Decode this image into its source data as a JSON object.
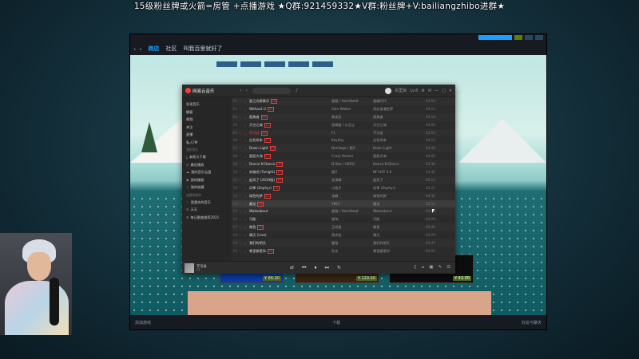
{
  "overlay": {
    "text": "15级粉丝牌或火箭=房管 +点播游戏 ★Q群:921459332★V群:粉丝牌+V:bailiangzhibo进群★"
  },
  "steam": {
    "nav": {
      "back": "‹",
      "forward": "›",
      "tabs": [
        "商店",
        "社区",
        "叫我百里就好了"
      ]
    },
    "bottom": {
      "add_game": "添加游戏",
      "downloads": "下载",
      "friends": "好友与聊天"
    },
    "prices": [
      "¥ 86.00",
      "¥ 129.60",
      "¥ 42.00"
    ]
  },
  "music": {
    "app_name": "网易云音乐",
    "header": {
      "username": "百里就",
      "level": "Lv.6"
    },
    "sidebar": {
      "items": [
        "发现音乐",
        "播客",
        "视频",
        "关注",
        "直播",
        "私人FM"
      ],
      "section_my": "我的音乐",
      "my_items": [
        "本地与下载",
        "最近播放",
        "我的音乐云盘",
        "我的播客",
        "我的收藏"
      ],
      "section_playlists": "创建的歌单",
      "playlists": [
        "我喜欢的音乐",
        "天天",
        "每日歌曲推荐2021"
      ]
    },
    "tracks": [
      {
        "no": "01",
        "title": "星之光辉奏乐",
        "tag": "SQ",
        "artist": "超级 / Heartbeat",
        "album": "超级时代",
        "duration": "03:54"
      },
      {
        "no": "02",
        "title": "Without U",
        "tag": "SQ",
        "artist": "Alan Walker",
        "album": "奇幻浪漫世界",
        "duration": "04:11"
      },
      {
        "no": "03",
        "title": "孤勇者",
        "tag": "MV",
        "artist": "陈奕迅",
        "album": "孤勇者",
        "duration": "04:16"
      },
      {
        "no": "04",
        "title": "天空之城",
        "tag": "SQ",
        "artist": "宫崎骏 / 久石让",
        "album": "天空之城",
        "duration": "04:06"
      },
      {
        "no": "05",
        "title": "不可说",
        "tag": "VIP",
        "artist": "F1",
        "album": "不可说",
        "duration": "03:53"
      },
      {
        "no": "06",
        "title": "白色风车",
        "tag": "SQ",
        "artist": "KayKay",
        "album": "白色风车",
        "duration": "04:12"
      },
      {
        "no": "07",
        "title": "Down Light",
        "tag": "SQ",
        "artist": "Danilego / 肥Z",
        "album": "Down Light",
        "duration": "03:48"
      },
      {
        "no": "08",
        "title": "星辰大海",
        "tag": "SQ",
        "artist": "Crazy Rocker",
        "album": "星辰大海",
        "duration": "04:02"
      },
      {
        "no": "09",
        "title": "Dance N Dance",
        "tag": "SQ",
        "artist": "D.Star / HERO",
        "album": "Dance N Dance",
        "duration": "03:36"
      },
      {
        "no": "10",
        "title": "奔跑吧 (Tonight)",
        "tag": "SQ",
        "artist": "肥Z",
        "album": "NF-HAT 3.0",
        "duration": "03:45"
      },
      {
        "no": "11",
        "title": "起风了 (2019版)",
        "tag": "SQ",
        "artist": "吴青峰",
        "album": "起风了",
        "duration": "05:13"
      },
      {
        "no": "12",
        "title": "风筝 (Zephyr)",
        "tag": "SQ",
        "artist": "小瓶子",
        "album": "风筝 (Zephyr)",
        "duration": "03:21"
      },
      {
        "no": "13",
        "title": "绿色的梦",
        "tag": "SQ",
        "artist": "张静",
        "album": "绿色的梦",
        "duration": "04:35"
      },
      {
        "no": "14",
        "title": "藏龙",
        "tag": "SQ",
        "artist": "YKEY",
        "album": "藏龙",
        "duration": "03:11"
      },
      {
        "no": "15",
        "title": "Wakeabout",
        "tag": "",
        "artist": "超级 / Heartbeat",
        "album": "Wakeabout",
        "duration": "03:58"
      },
      {
        "no": "16",
        "title": "可能",
        "tag": "",
        "artist": "程响",
        "album": "可能",
        "duration": "04:20"
      },
      {
        "no": "17",
        "title": "像鱼",
        "tag": "SQ",
        "artist": "王贰浪",
        "album": "像鱼",
        "duration": "04:46"
      },
      {
        "no": "18",
        "title": "晴天 (Live)",
        "tag": "",
        "artist": "周杰伦",
        "album": "晴天",
        "duration": "04:29"
      },
      {
        "no": "19",
        "title": "我们的明天",
        "tag": "",
        "artist": "鹿晗",
        "album": "我们的明天",
        "duration": "03:47"
      },
      {
        "no": "20",
        "title": "哪里都是你",
        "tag": "SQ",
        "artist": "队长",
        "album": "哪里都是你",
        "duration": "04:01"
      }
    ],
    "player": {
      "now_title": "不可说",
      "now_artist": "F1",
      "controls": [
        "⇄",
        "⏮",
        "⏸",
        "⏭",
        "↻"
      ],
      "extras": [
        "♫",
        "⌂",
        "▣",
        "✎",
        "☰"
      ]
    }
  }
}
